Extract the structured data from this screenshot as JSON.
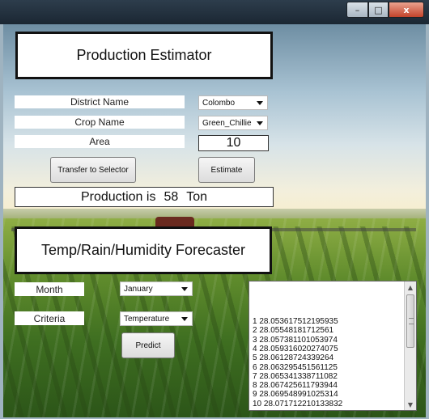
{
  "window": {
    "title": "",
    "buttons": {
      "minimize": "–",
      "maximize": "□",
      "close": "x"
    }
  },
  "production": {
    "title": "Production Estimator",
    "district_label": "District Name",
    "district_value": "Colombo",
    "crop_label": "Crop Name",
    "crop_value": "Green_Chillie",
    "area_label": "Area",
    "area_value": "10",
    "transfer_button": "Transfer to Selector",
    "estimate_button": "Estimate",
    "result_prefix": "Production is",
    "result_value": "58",
    "result_unit": "Ton"
  },
  "forecaster": {
    "title": "Temp/Rain/Humidity Forecaster",
    "month_label": "Month",
    "month_value": "January",
    "criteria_label": "Criteria",
    "criteria_value": "Temperature",
    "predict_button": "Predict",
    "results": [
      "1 28.053617512195935",
      "2 28.05548181712561",
      "3 28.057381101053974",
      "4 28.059316020274075",
      "5 28.06128724339264",
      "6 28.063295451561125",
      "7 28.065341338711082",
      "8 28.067425611793944",
      "9 28.069548991025314",
      "10 28.071712210133832"
    ]
  },
  "icons": {
    "dropdown": "chevron-down-icon",
    "scroll_up": "arrow-up-icon",
    "scroll_down": "arrow-down-icon"
  }
}
